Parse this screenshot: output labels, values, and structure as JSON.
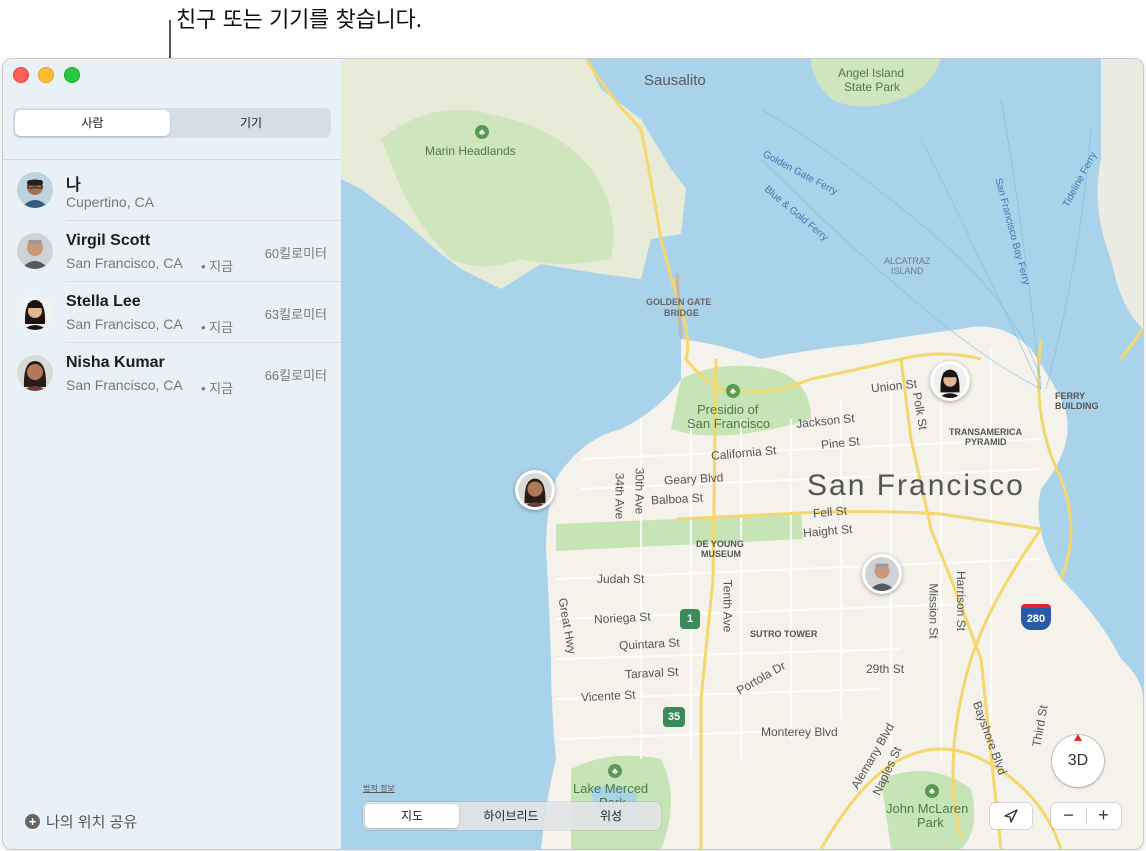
{
  "callout": {
    "text": "친구 또는 기기를 찾습니다."
  },
  "tabs": {
    "people": "사람",
    "devices": "기기",
    "active": "people"
  },
  "people": [
    {
      "name": "나",
      "location": "Cupertino, CA",
      "time": "",
      "distance": ""
    },
    {
      "name": "Virgil Scott",
      "location": "San Francisco, CA",
      "time": "• 지금",
      "distance": "60킬로미터"
    },
    {
      "name": "Stella Lee",
      "location": "San Francisco, CA",
      "time": "• 지금",
      "distance": "63킬로미터"
    },
    {
      "name": "Nisha Kumar",
      "location": "San Francisco, CA",
      "time": "• 지금",
      "distance": "66킬로미터"
    }
  ],
  "share_location": {
    "label": "나의 위치 공유"
  },
  "map": {
    "labels": {
      "sausalito": "Sausalito",
      "angel_island": "Angel Island",
      "angel_island_2": "State Park",
      "marin_headlands": "Marin Headlands",
      "golden_gate_ferry": "Golden Gate Ferry",
      "blue_gold_ferry": "Blue & Gold Ferry",
      "alcatraz": "ALCATRAZ",
      "alcatraz_2": "ISLAND",
      "sf_bay_ferry": "San Francisco Bay Ferry",
      "tideline_ferry": "Tideline Ferry",
      "golden_gate_bridge": "GOLDEN GATE",
      "golden_gate_bridge_2": "BRIDGE",
      "presidio": "Presidio of",
      "presidio_2": "San Francisco",
      "union_st": "Union St",
      "polk_st": "Polk St",
      "ferry_building": "FERRY",
      "ferry_building_2": "BUILDING",
      "transamerica": "TRANSAMERICA",
      "transamerica_2": "PYRAMID",
      "jackson_st": "Jackson St",
      "pine_st": "Pine St",
      "california_st": "California St",
      "geary_blvd": "Geary Blvd",
      "balboa_st": "Balboa St",
      "ave_30th": "30th Ave",
      "ave_34th": "34th Ave",
      "san_francisco": "San Francisco",
      "fell_st": "Fell St",
      "haight_st": "Haight St",
      "de_young": "DE YOUNG",
      "de_young_2": "MUSEUM",
      "judah_st": "Judah St",
      "great_hwy": "Great Hwy",
      "noriega_st": "Noriega St",
      "tenth_ave": "Tenth Ave",
      "quintara_st": "Quintara St",
      "sutro_tower": "SUTRO TOWER",
      "taraval_st": "Taraval St",
      "portola_dr": "Portola Dr",
      "vicente_st": "Vicente St",
      "mission_st": "Mission St",
      "harrison_st": "Harrison St",
      "st_29th": "29th St",
      "monterey_blvd": "Monterey Blvd",
      "alemany_blvd": "Alemany Blvd",
      "naples_st": "Naples St",
      "bayshore_blvd": "Bayshore Blvd",
      "third_st": "Third St",
      "lake_merced": "Lake Merced",
      "lake_merced_2": "Park",
      "john_mclaren": "John McLaren",
      "john_mclaren_2": "Park",
      "hwy_1": "1",
      "hwy_35": "35",
      "i_280": "280"
    },
    "legal": "법적 정보",
    "modes": {
      "map": "지도",
      "hybrid": "하이브리드",
      "satellite": "위성",
      "active": "map"
    },
    "compass_label": "3D",
    "zoom_out": "−",
    "zoom_in": "+",
    "colors": {
      "water": "#a9d3ea",
      "land": "#f4f2ea",
      "park": "#c7e4b7",
      "road": "#f5d76e"
    }
  }
}
